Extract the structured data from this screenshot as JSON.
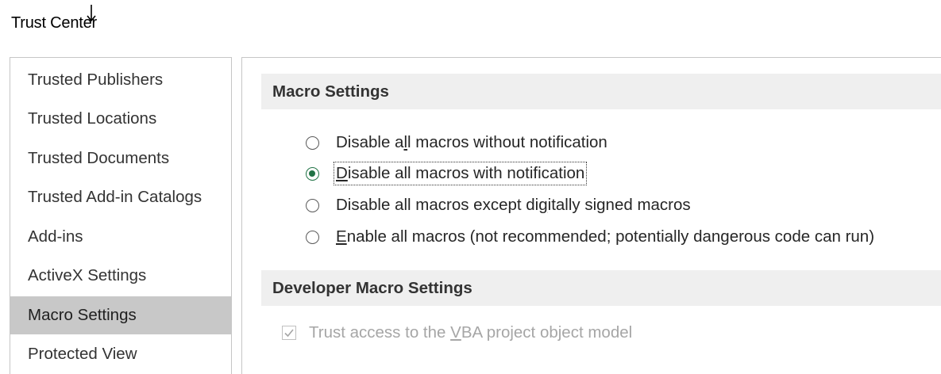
{
  "window": {
    "title": "Trust Center"
  },
  "nav": {
    "items": [
      {
        "label": "Trusted Publishers",
        "selected": false
      },
      {
        "label": "Trusted Locations",
        "selected": false
      },
      {
        "label": "Trusted Documents",
        "selected": false
      },
      {
        "label": "Trusted Add-in Catalogs",
        "selected": false
      },
      {
        "label": "Add-ins",
        "selected": false
      },
      {
        "label": "ActiveX Settings",
        "selected": false
      },
      {
        "label": "Macro Settings",
        "selected": true
      },
      {
        "label": "Protected View",
        "selected": false
      }
    ]
  },
  "macro_settings": {
    "header": "Macro Settings",
    "options": [
      {
        "label": "Disable all macros without notification",
        "checked": false
      },
      {
        "label": "Disable all macros with notification",
        "checked": true
      },
      {
        "label": "Disable all macros except digitally signed macros",
        "checked": false
      },
      {
        "label": "Enable all macros (not recommended; potentially dangerous code can run)",
        "checked": false
      }
    ]
  },
  "developer_settings": {
    "header": "Developer Macro Settings",
    "trust_vba": {
      "label": "Trust access to the VBA project object model",
      "checked": true,
      "enabled": false
    }
  },
  "colors": {
    "selected_nav_bg": "#c8c8c8",
    "section_header_bg": "#efefef",
    "radio_accent": "#217346",
    "disabled_text": "#a6a6a6"
  }
}
